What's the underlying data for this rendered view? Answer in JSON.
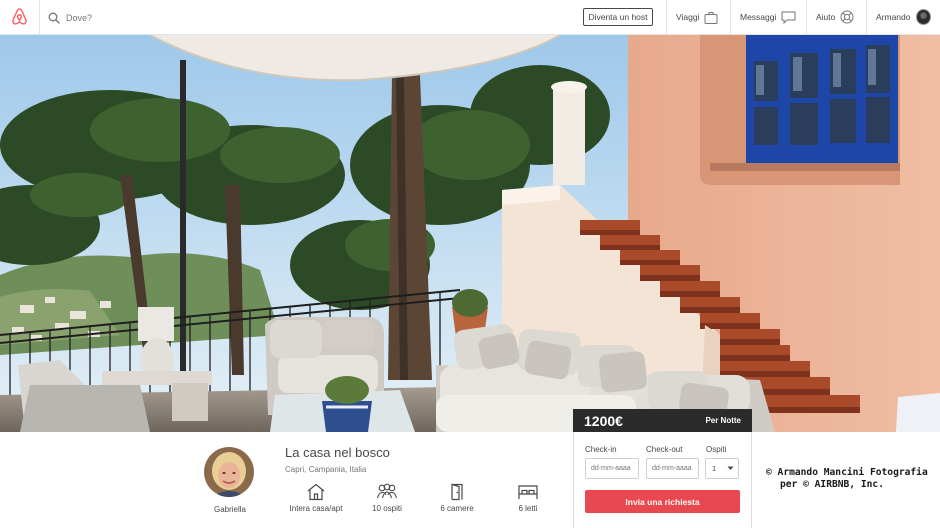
{
  "header": {
    "logo": "airbnb-logo",
    "search_placeholder": "Dove?",
    "host_button": "Diventa un host",
    "nav": {
      "trips": "Viaggi",
      "messages": "Messaggi",
      "help": "Aiuto",
      "user": "Armando"
    }
  },
  "listing": {
    "price": "1200€",
    "price_unit": "Per Notte",
    "title": "La casa nel bosco",
    "location": "Capri, Campania, Italia",
    "host": {
      "name": "Gabriella"
    },
    "features": [
      {
        "icon": "house-icon",
        "label": "Intera casa/apt"
      },
      {
        "icon": "guests-icon",
        "label": "10 ospiti"
      },
      {
        "icon": "door-icon",
        "label": "6 camere"
      },
      {
        "icon": "bed-icon",
        "label": "6 letti"
      }
    ]
  },
  "booking": {
    "checkin_label": "Check-in",
    "checkout_label": "Check-out",
    "guests_label": "Ospiti",
    "checkin_placeholder": "dd-mm-aaaa",
    "checkout_placeholder": "dd-mm-aaaa",
    "guests_value": "1",
    "request_button": "Invia una richiesta"
  },
  "photo_credit": {
    "line1": "© Armando Mancini Fotografia",
    "line2": "per © AIRBNB, Inc."
  },
  "colors": {
    "brand": "#ff5a5f",
    "request_button": "#e8484f",
    "price_bar": "#2b2b2b",
    "text": "#484848"
  }
}
